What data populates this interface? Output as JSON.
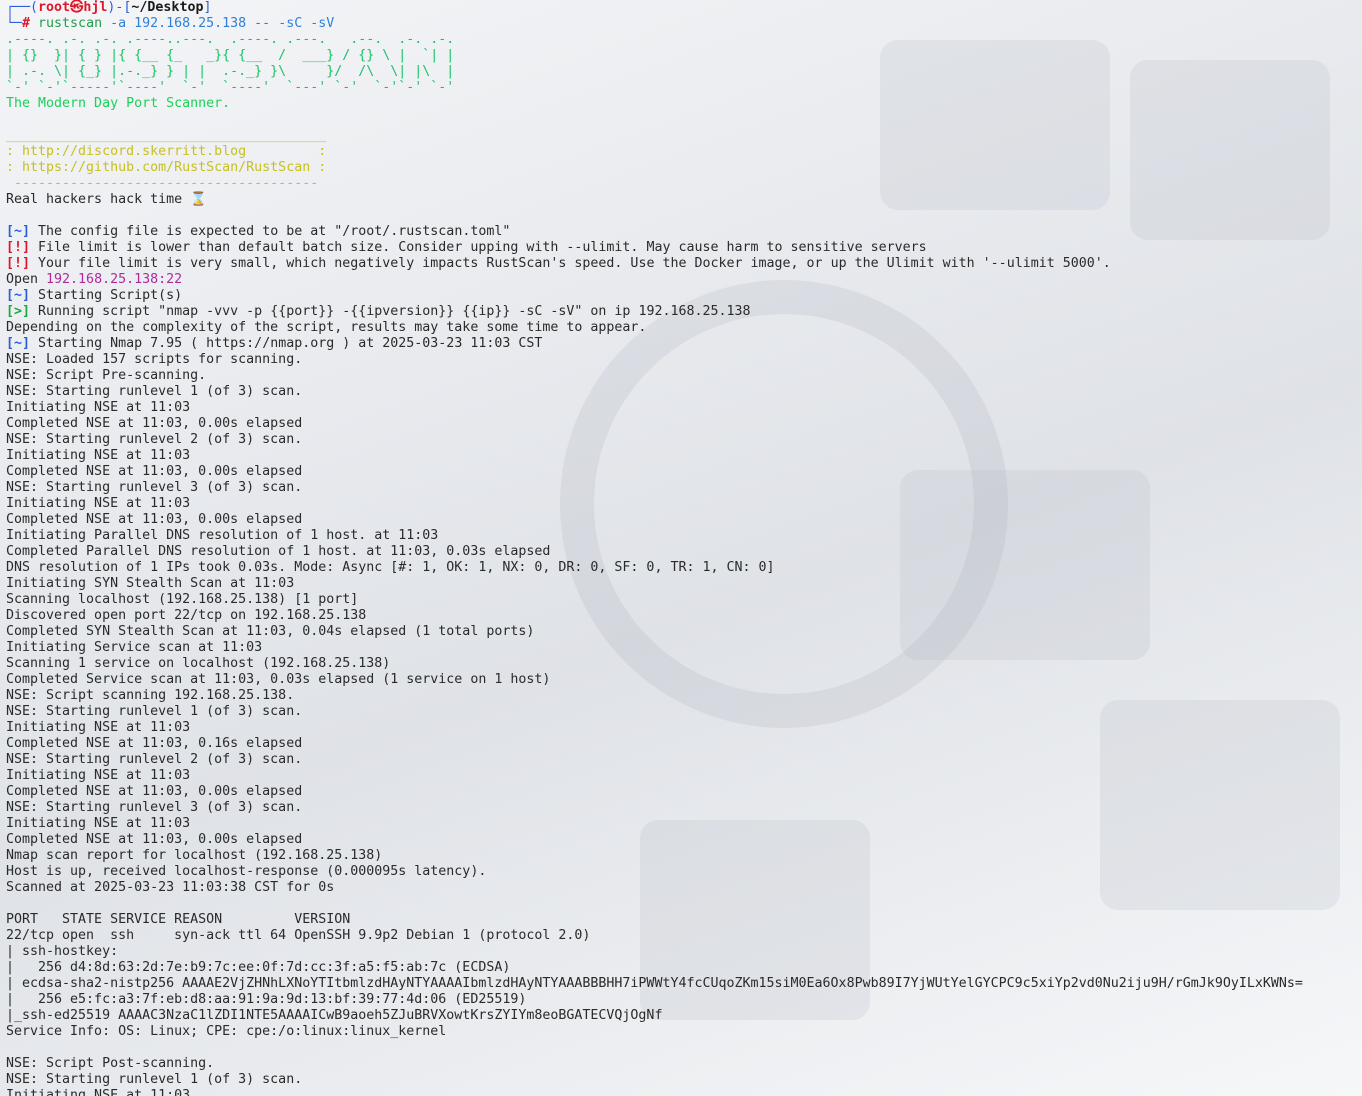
{
  "prompt": {
    "frame_top": "┌──(",
    "user": "root㉿hjl",
    "mid": ")-[",
    "dir": "~/Desktop",
    "end": "]",
    "frame_bottom": "└─",
    "hash": "# ",
    "cmd": "rustscan",
    "args": " -a 192.168.25.138 -- -sC -sV"
  },
  "banner": [
    ".----. .-. .-. .----..---.  .----. .---.   .--.  .-. .-.",
    "| {}  }| { } |{ {__ {_   _}{ {__  /  ___} / {} \\ |  `| |",
    "| .-. \\| {_} |.-._} } | |  .-._} }\\     }/  /\\  \\| |\\  |",
    "`-' `-'`-----'`----'  `-'  `----'  `---' `-'  `-'`-' `-'"
  ],
  "tagline": "The Modern Day Port Scanner.",
  "info_box": {
    "rule_top": "________________________________________",
    "link1": ": http://discord.skerritt.blog         :",
    "link2": ": https://github.com/RustScan/RustScan :",
    "rule_bottom": " --------------------------------------"
  },
  "quote": "Real hackers hack time ⌛",
  "messages": [
    {
      "tag": "[~]",
      "kind": "info",
      "text": " The config file is expected to be at \"/root/.rustscan.toml\""
    },
    {
      "tag": "[!]",
      "kind": "warn",
      "text": " File limit is lower than default batch size. Consider upping with --ulimit. May cause harm to sensitive servers"
    },
    {
      "tag": "[!]",
      "kind": "warn",
      "text": " Your file limit is very small, which negatively impacts RustScan's speed. Use the Docker image, or up the Ulimit with '--ulimit 5000'."
    }
  ],
  "open_line": {
    "label": "Open ",
    "target": "192.168.25.138:22"
  },
  "script_messages": [
    {
      "tag": "[~]",
      "kind": "info",
      "text": " Starting Script(s)"
    },
    {
      "tag": "[>]",
      "kind": "run",
      "text": " Running script \"nmap -vvv -p {{port}} -{{ipversion}} {{ip}} -sC -sV\" on ip 192.168.25.138"
    },
    {
      "tag": "",
      "kind": "plain",
      "text": "Depending on the complexity of the script, results may take some time to appear."
    },
    {
      "tag": "[~]",
      "kind": "info",
      "text": " Starting Nmap 7.95 ( https://nmap.org ) at 2025-03-23 11:03 CST"
    }
  ],
  "nmap_output": [
    "NSE: Loaded 157 scripts for scanning.",
    "NSE: Script Pre-scanning.",
    "NSE: Starting runlevel 1 (of 3) scan.",
    "Initiating NSE at 11:03",
    "Completed NSE at 11:03, 0.00s elapsed",
    "NSE: Starting runlevel 2 (of 3) scan.",
    "Initiating NSE at 11:03",
    "Completed NSE at 11:03, 0.00s elapsed",
    "NSE: Starting runlevel 3 (of 3) scan.",
    "Initiating NSE at 11:03",
    "Completed NSE at 11:03, 0.00s elapsed",
    "Initiating Parallel DNS resolution of 1 host. at 11:03",
    "Completed Parallel DNS resolution of 1 host. at 11:03, 0.03s elapsed",
    "DNS resolution of 1 IPs took 0.03s. Mode: Async [#: 1, OK: 1, NX: 0, DR: 0, SF: 0, TR: 1, CN: 0]",
    "Initiating SYN Stealth Scan at 11:03",
    "Scanning localhost (192.168.25.138) [1 port]",
    "Discovered open port 22/tcp on 192.168.25.138",
    "Completed SYN Stealth Scan at 11:03, 0.04s elapsed (1 total ports)",
    "Initiating Service scan at 11:03",
    "Scanning 1 service on localhost (192.168.25.138)",
    "Completed Service scan at 11:03, 0.03s elapsed (1 service on 1 host)",
    "NSE: Script scanning 192.168.25.138.",
    "NSE: Starting runlevel 1 (of 3) scan.",
    "Initiating NSE at 11:03",
    "Completed NSE at 11:03, 0.16s elapsed",
    "NSE: Starting runlevel 2 (of 3) scan.",
    "Initiating NSE at 11:03",
    "Completed NSE at 11:03, 0.00s elapsed",
    "NSE: Starting runlevel 3 (of 3) scan.",
    "Initiating NSE at 11:03",
    "Completed NSE at 11:03, 0.00s elapsed",
    "Nmap scan report for localhost (192.168.25.138)",
    "Host is up, received localhost-response (0.000095s latency).",
    "Scanned at 2025-03-23 11:03:38 CST for 0s",
    "",
    "PORT   STATE SERVICE REASON         VERSION",
    "22/tcp open  ssh     syn-ack ttl 64 OpenSSH 9.9p2 Debian 1 (protocol 2.0)",
    "| ssh-hostkey: ",
    "|   256 d4:8d:63:2d:7e:b9:7c:ee:0f:7d:cc:3f:a5:f5:ab:7c (ECDSA)",
    "| ecdsa-sha2-nistp256 AAAAE2VjZHNhLXNoYTItbmlzdHAyNTYAAAAIbmlzdHAyNTYAAABBBHH7iPWWtY4fcCUqoZKm15siM0Ea6Ox8Pwb89I7YjWUtYelGYCPC9c5xiYp2vd0Nu2iju9H/rGmJk9OyILxKWNs=",
    "|   256 e5:fc:a3:7f:eb:d8:aa:91:9a:9d:13:bf:39:77:4d:06 (ED25519)",
    "|_ssh-ed25519 AAAAC3NzaC1lZDI1NTE5AAAAICwB9aoeh5ZJuBRVXowtKrsZYIYm8eoBGATECVQjOgNf",
    "Service Info: OS: Linux; CPE: cpe:/o:linux:linux_kernel",
    "",
    "NSE: Script Post-scanning.",
    "NSE: Starting runlevel 1 (of 3) scan.",
    "Initiating NSE at 11:03"
  ],
  "colors": {
    "frame": "#2c5fd6",
    "user": "#e0162b",
    "banner": "#18c466",
    "links": "#c7c020",
    "open_ip": "#b02a9b",
    "run_tag": "#19a83c"
  }
}
